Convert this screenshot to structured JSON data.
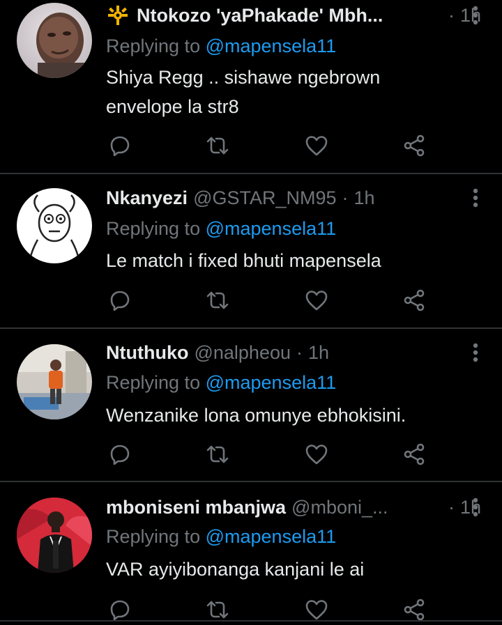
{
  "tweets": [
    {
      "display_name": "Ntokozo 'yaPhakade' Mbh...",
      "handle": "",
      "dot": "·",
      "time": "1h",
      "reply_prefix": "Replying to",
      "reply_to": "@mapensela11",
      "text": "Shiya Regg .. sishawe ngebrown envelope la str8",
      "has_badge": true,
      "badge_icon": "ship-wheel-icon",
      "badge_color": "#f4b400",
      "avatar_icon": "profile-photo-man-closeup-icon"
    },
    {
      "display_name": "Nkanyezi",
      "handle": "@GSTAR_NM95",
      "dot": "·",
      "time": "1h",
      "reply_prefix": "Replying to",
      "reply_to": "@mapensela11",
      "text": "Le match i fixed bhuti mapensela",
      "has_badge": false,
      "avatar_icon": "meme-face-drawing-icon"
    },
    {
      "display_name": "Ntuthuko",
      "handle": "@nalpheou",
      "dot": "·",
      "time": "1h",
      "reply_prefix": "Replying to",
      "reply_to": "@mapensela11",
      "text": "Wenzanike lona omunye ebhokisini.",
      "has_badge": false,
      "avatar_icon": "profile-photo-man-in-room-icon"
    },
    {
      "display_name": "mboniseni mbanjwa",
      "handle": "@mboni_...",
      "dot": "·",
      "time": "1h",
      "reply_prefix": "Replying to",
      "reply_to": "@mapensela11",
      "text": "VAR ayiyibonanga kanjani le ai",
      "has_badge": false,
      "avatar_icon": "profile-photo-man-red-background-icon"
    }
  ],
  "colors": {
    "background": "#000000",
    "primary_text": "#e7e9ea",
    "secondary_text": "#71767b",
    "mention": "#1d9bf0",
    "divider": "#2f3336"
  },
  "action_icons": [
    "reply-icon",
    "retweet-icon",
    "like-icon",
    "share-icon"
  ]
}
